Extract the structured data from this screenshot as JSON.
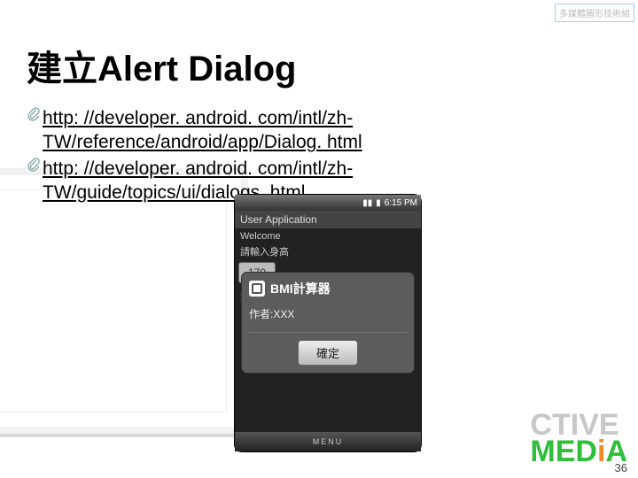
{
  "corner_tag": "多媒體圖形技術組",
  "title": "建立Alert Dialog",
  "links": [
    {
      "line1": "http: //developer. android. com/intl/zh-",
      "line2": "TW/reference/android/app/Dialog. html"
    },
    {
      "line1": "http: //developer. android. com/intl/zh-",
      "line2": "TW/guide/topics/ui/dialogs. html"
    }
  ],
  "phone": {
    "status_time": "6:15 PM",
    "app_header": "User Application",
    "welcome": "Welcome",
    "prompt1": "請輸入身高",
    "value1": "170",
    "prompt2": "請輸入體重",
    "dialog": {
      "title": "BMI計算器",
      "body": "作者:XXX",
      "button": "確定"
    },
    "nav_label": "MENU"
  },
  "logo": {
    "line1": "CTIVE",
    "line2_pre": "MED",
    "line2_i": "i",
    "line2_post": "A"
  },
  "page_number": "36"
}
